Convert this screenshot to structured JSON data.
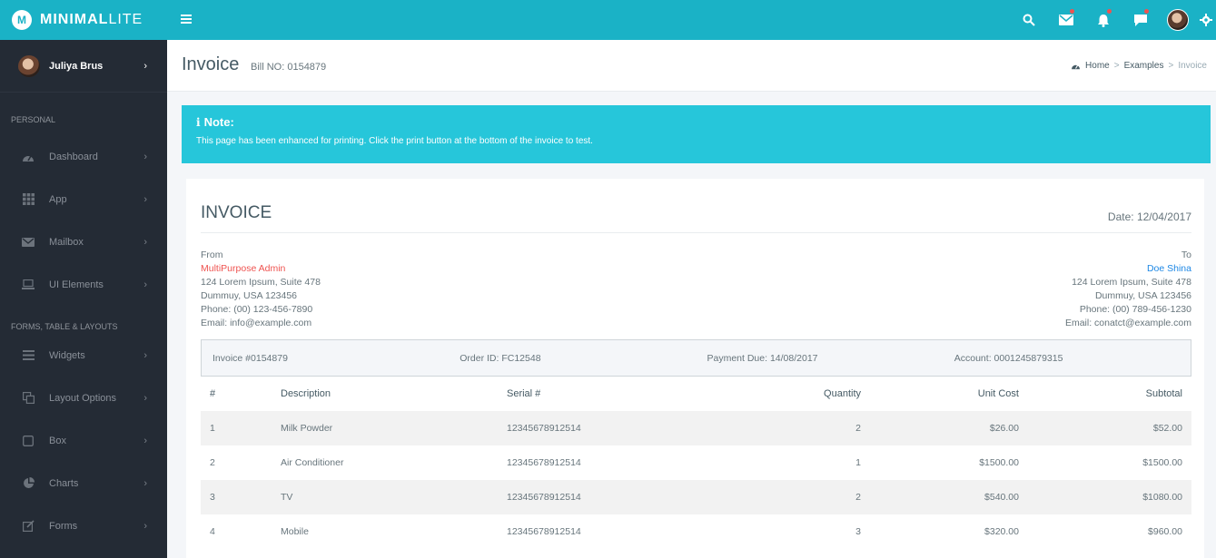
{
  "brand": {
    "logo_letter": "M",
    "name_bold": "MINIMAL",
    "name_light": "LITE"
  },
  "topbar": {
    "icons": [
      "search-icon",
      "mail-icon",
      "bell-icon",
      "chat-icon",
      "avatar",
      "gear-icon"
    ],
    "accent": "#1ab2c6"
  },
  "sidebar": {
    "user_name": "Juliya Brus",
    "sections": [
      {
        "header": "PERSONAL",
        "items": [
          {
            "label": "Dashboard",
            "icon": "dashboard-icon"
          },
          {
            "label": "App",
            "icon": "grid-icon"
          },
          {
            "label": "Mailbox",
            "icon": "envelope-icon"
          },
          {
            "label": "UI Elements",
            "icon": "laptop-icon"
          }
        ]
      },
      {
        "header": "FORMS, TABLE & LAYOUTS",
        "items": [
          {
            "label": "Widgets",
            "icon": "bars-icon"
          },
          {
            "label": "Layout Options",
            "icon": "copy-icon"
          },
          {
            "label": "Box",
            "icon": "square-icon"
          },
          {
            "label": "Charts",
            "icon": "pie-chart-icon"
          },
          {
            "label": "Forms",
            "icon": "edit-icon"
          }
        ]
      }
    ]
  },
  "page": {
    "title": "Invoice",
    "subtitle": "Bill NO: 0154879",
    "breadcrumb": {
      "home": "Home",
      "section": "Examples",
      "current": "Invoice"
    }
  },
  "note": {
    "icon": "info-icon",
    "title": "Note:",
    "text": "This page has been enhanced for printing. Click the print button at the bottom of the invoice to test."
  },
  "invoice": {
    "heading": "INVOICE",
    "date": "Date: 12/04/2017",
    "from": {
      "label": "From",
      "name": "MultiPurpose Admin",
      "line1": "124 Lorem Ipsum, Suite 478",
      "line2": "Dummuy, USA 123456",
      "phone": "Phone: (00) 123-456-7890",
      "email": "Email: info@example.com"
    },
    "to": {
      "label": "To",
      "name": "Doe Shina",
      "line1": "124 Lorem Ipsum, Suite 478",
      "line2": "Dummuy, USA 123456",
      "phone": "Phone: (00) 789-456-1230",
      "email": "Email: conatct@example.com"
    },
    "meta": {
      "invoice_no": "Invoice #0154879",
      "order_id": "Order ID: FC12548",
      "payment_due": "Payment Due: 14/08/2017",
      "account": "Account: 0001245879315"
    },
    "columns": [
      "#",
      "Description",
      "Serial #",
      "Quantity",
      "Unit Cost",
      "Subtotal"
    ],
    "rows": [
      {
        "num": "1",
        "description": "Milk Powder",
        "serial": "12345678912514",
        "quantity": "2",
        "unit_cost": "$26.00",
        "subtotal": "$52.00"
      },
      {
        "num": "2",
        "description": "Air Conditioner",
        "serial": "12345678912514",
        "quantity": "1",
        "unit_cost": "$1500.00",
        "subtotal": "$1500.00"
      },
      {
        "num": "3",
        "description": "TV",
        "serial": "12345678912514",
        "quantity": "2",
        "unit_cost": "$540.00",
        "subtotal": "$1080.00"
      },
      {
        "num": "4",
        "description": "Mobile",
        "serial": "12345678912514",
        "quantity": "3",
        "unit_cost": "$320.00",
        "subtotal": "$960.00"
      }
    ]
  }
}
